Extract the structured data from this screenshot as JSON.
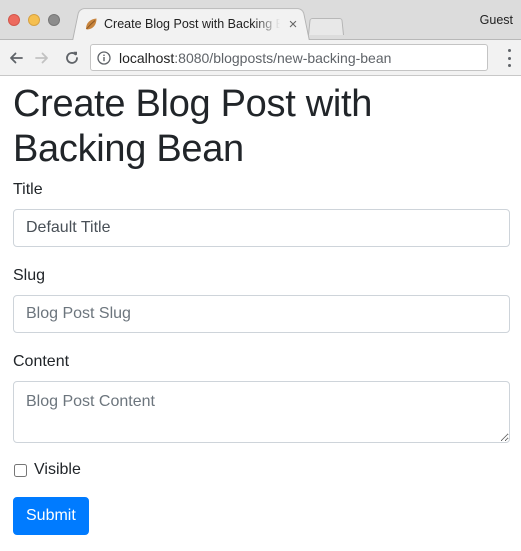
{
  "browser": {
    "tab_title": "Create Blog Post with Backing Bean",
    "tab_close": "×",
    "profile_label": "Guest",
    "url_host": "localhost",
    "url_rest": ":8080/blogposts/new-backing-bean"
  },
  "page": {
    "heading": "Create Blog Post with Backing Bean",
    "title_label": "Title",
    "title_value": "Default Title",
    "slug_label": "Slug",
    "slug_placeholder": "Blog Post Slug",
    "content_label": "Content",
    "content_placeholder": "Blog Post Content",
    "visible_label": "Visible",
    "visible_checked": false,
    "submit_label": "Submit"
  },
  "colors": {
    "primary": "#007bff",
    "text": "#212529",
    "input_border": "#ced4da",
    "placeholder": "#6c757d"
  },
  "icons": {
    "favicon": "spring-leaf-icon",
    "back": "arrow-left-icon",
    "forward": "arrow-right-icon",
    "reload": "reload-icon",
    "site_info": "info-icon",
    "menu": "more-vertical-icon"
  }
}
